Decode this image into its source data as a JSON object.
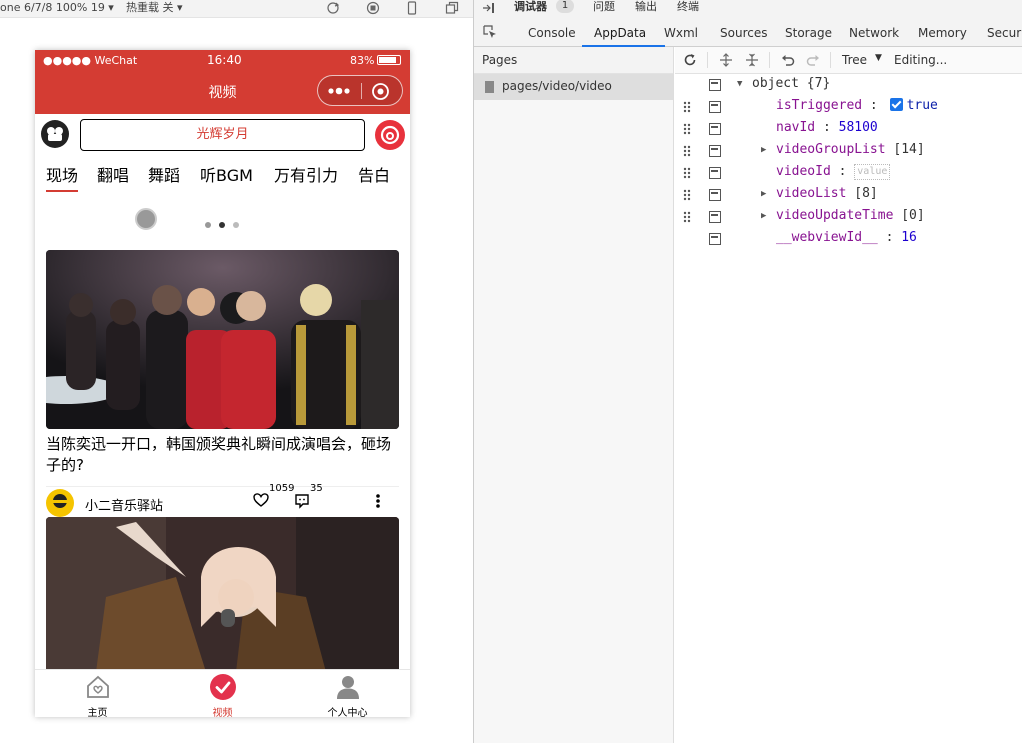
{
  "simulator": {
    "device_label": "one 6/7/8 100% 19 ▾",
    "hot_reload_label": "热重载 关 ▾"
  },
  "phone": {
    "status": {
      "carrier": "●●●●● WeChat",
      "time": "16:40",
      "battery": "83%"
    },
    "nav_title": "视频",
    "search_placeholder": "光辉岁月",
    "tabs": [
      "现场",
      "翻唱",
      "舞蹈",
      "听BGM",
      "万有引力",
      "告白"
    ],
    "active_tab": 0,
    "carousel_dots": 3,
    "active_dot": 1,
    "video1": {
      "title": "当陈奕迅一开口，韩国颁奖典礼瞬间成演唱会，砸场子的?",
      "author": "小二音乐驿站",
      "likes": "1059",
      "comments": "35"
    },
    "tabbar": [
      {
        "label": "主页",
        "icon": "home-icon"
      },
      {
        "label": "视频",
        "icon": "video-check-icon"
      },
      {
        "label": "个人中心",
        "icon": "user-icon"
      }
    ],
    "tabbar_active": 1,
    "colors": {
      "brand_red": "#d43c33",
      "active_tab_blue": "#1a73e8"
    }
  },
  "devtools": {
    "top_items": [
      "调试器",
      "1",
      "问题",
      "输出",
      "终端"
    ],
    "tabs": [
      "Console",
      "AppData",
      "Wxml",
      "Sources",
      "Storage",
      "Network",
      "Memory",
      "Securit"
    ],
    "active_tab": "AppData",
    "pages_header": "Pages",
    "pages": [
      "pages/video/video"
    ],
    "toolbar": {
      "tree_label": "Tree",
      "editing_label": "Editing..."
    },
    "tree": {
      "root": "object",
      "root_count": "{7}",
      "rows": [
        {
          "key": "isTriggered",
          "value": "true",
          "type": "bool"
        },
        {
          "key": "navId",
          "value": "58100",
          "type": "number"
        },
        {
          "key": "videoGroupList",
          "value": "[14]",
          "type": "array"
        },
        {
          "key": "videoId",
          "value": "value",
          "type": "empty"
        },
        {
          "key": "videoList",
          "value": "[8]",
          "type": "array"
        },
        {
          "key": "videoUpdateTime",
          "value": "[0]",
          "type": "array"
        },
        {
          "key": "__webviewId__",
          "value": "16",
          "type": "number"
        }
      ]
    }
  }
}
